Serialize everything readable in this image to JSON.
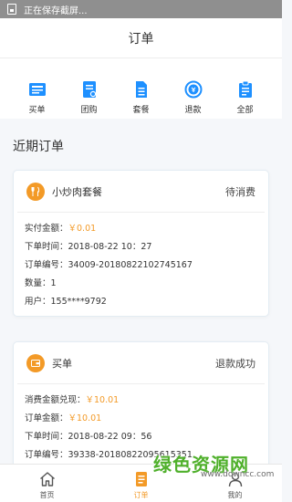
{
  "status_bar": {
    "text": "正在保存截屏..."
  },
  "header": {
    "title": "订单"
  },
  "quick_actions": [
    {
      "label": "买单",
      "icon": "register-icon"
    },
    {
      "label": "团购",
      "icon": "group-buy-icon"
    },
    {
      "label": "套餐",
      "icon": "package-icon"
    },
    {
      "label": "退款",
      "icon": "refund-icon"
    },
    {
      "label": "全部",
      "icon": "clipboard-icon"
    }
  ],
  "recent": {
    "title": "近期订单"
  },
  "orders": [
    {
      "name": "小炒肉套餐",
      "status": "待消费",
      "icon": "utensils-icon",
      "paid_label": "实付金额：",
      "paid_value": "￥0.01",
      "time": "下单时间：2018-08-22 10：27",
      "order_no": "订单编号：34009-20180822102745167",
      "quantity": "数量：1",
      "user": "用户：155****9792"
    },
    {
      "name": "买单",
      "status": "退款成功",
      "icon": "wallet-icon",
      "redeem_label": "消费金额兑现：",
      "redeem_value": "￥10.01",
      "amount_label": "订单金额：",
      "amount_value": "￥10.01",
      "time": "下单时间：2018-08-22 09：56",
      "order_no": "订单编号：39338-20180822095615351"
    }
  ],
  "tabs": [
    {
      "label": "首页",
      "icon": "home-icon",
      "active": false
    },
    {
      "label": "订单",
      "icon": "order-icon",
      "active": true
    },
    {
      "label": "我的",
      "icon": "user-icon",
      "active": false
    }
  ],
  "watermark": {
    "main": "绿色资源网",
    "sub": "www.downcc.com"
  },
  "colors": {
    "accent": "#f39a27",
    "primary_blue": "#1e90ff",
    "watermark_green": "#4fb02b"
  }
}
